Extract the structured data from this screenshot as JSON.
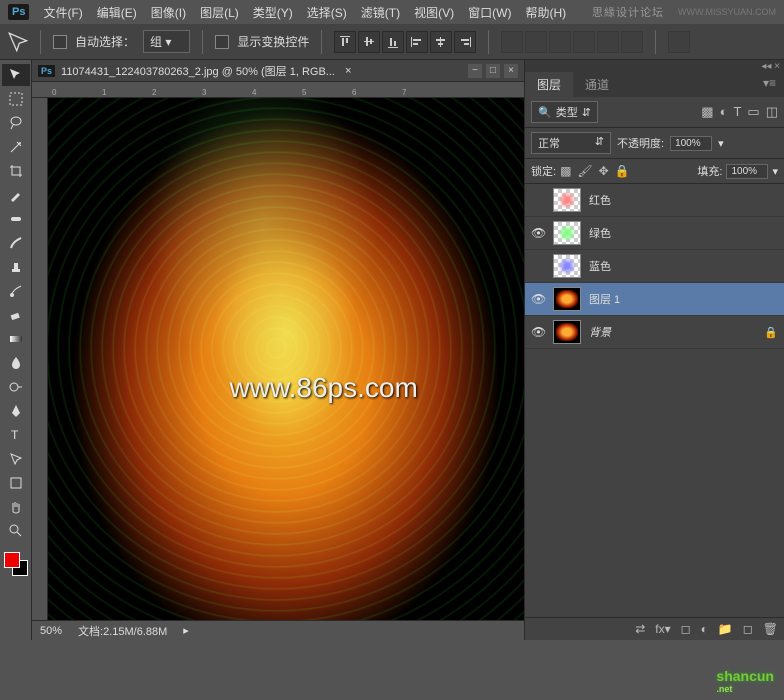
{
  "menubar": {
    "items": [
      "文件(F)",
      "编辑(E)",
      "图像(I)",
      "图层(L)",
      "类型(Y)",
      "选择(S)",
      "滤镜(T)",
      "视图(V)",
      "窗口(W)",
      "帮助(H)"
    ],
    "brand": "思緣设计论坛",
    "url": "WWW.MISSYUAN.COM"
  },
  "optbar": {
    "auto_select_label": "自动选择：",
    "auto_select_value": "组",
    "show_transform_label": "显示变换控件"
  },
  "document": {
    "tab_title": "11074431_122403780263_2.jpg @ 50% (图层 1, RGB...",
    "zoom": "50%",
    "doc_info": "文档:2.15M/6.88M",
    "ruler_marks": [
      "0",
      "1",
      "2",
      "3",
      "4",
      "5",
      "6",
      "7"
    ]
  },
  "watermark": "www.86ps.com",
  "panels": {
    "tabs": [
      "图层",
      "通道"
    ],
    "active_tab": 0,
    "filter_label": "类型",
    "blend_mode": "正常",
    "opacity_label": "不透明度:",
    "opacity_value": "100%",
    "lock_label": "锁定:",
    "fill_label": "填充:",
    "fill_value": "100%",
    "layers": [
      {
        "visible": false,
        "name": "红色",
        "thumb": "red",
        "locked": false
      },
      {
        "visible": true,
        "name": "绿色",
        "thumb": "green",
        "locked": false
      },
      {
        "visible": false,
        "name": "蓝色",
        "thumb": "blue",
        "locked": false
      },
      {
        "visible": true,
        "name": "图层 1",
        "thumb": "fire",
        "locked": false,
        "selected": true
      },
      {
        "visible": true,
        "name": "背景",
        "thumb": "fire",
        "locked": true,
        "italic": true
      }
    ]
  },
  "bottom_brand": {
    "name": "shancun",
    "sub": ".net"
  }
}
